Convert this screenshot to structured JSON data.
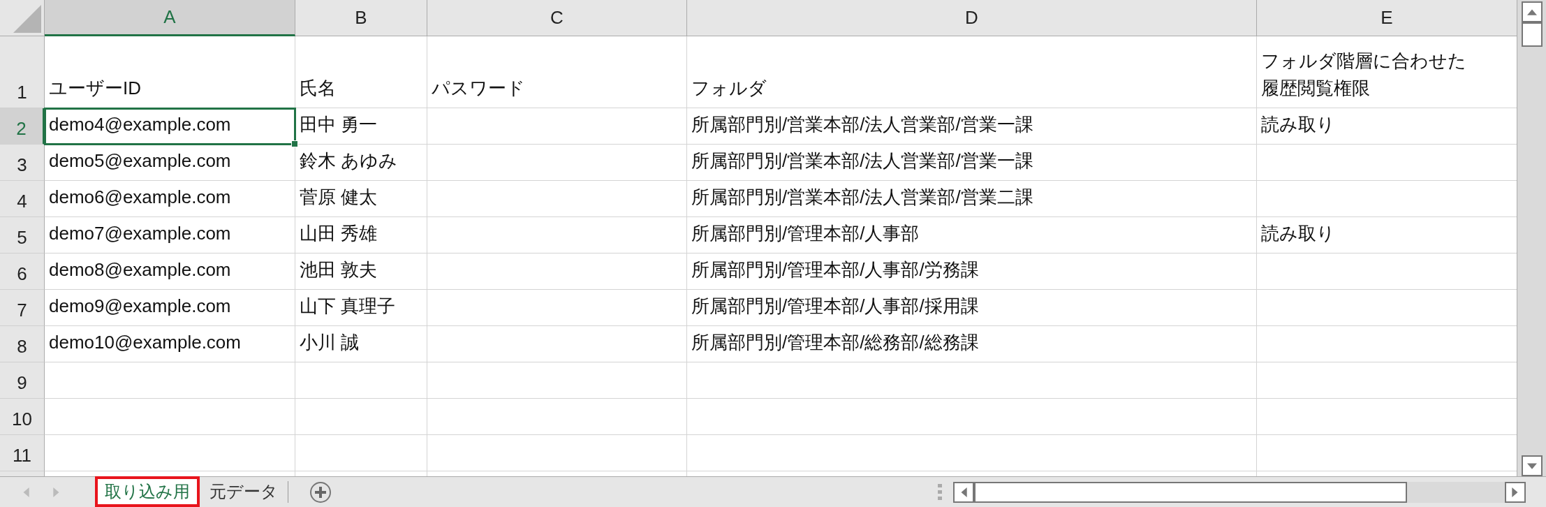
{
  "columns": [
    {
      "label": "A",
      "selected": true
    },
    {
      "label": "B",
      "selected": false
    },
    {
      "label": "C",
      "selected": false
    },
    {
      "label": "D",
      "selected": false
    },
    {
      "label": "E",
      "selected": false
    }
  ],
  "rows": [
    {
      "number": "1",
      "selected": false,
      "cells": [
        "ユーザーID",
        "氏名",
        "パスワード",
        "フォルダ",
        "フォルダ階層に合わせた履歴閲覧権限"
      ]
    },
    {
      "number": "2",
      "selected": true,
      "cells": [
        "demo4@example.com",
        "田中 勇一",
        null,
        "所属部門別/営業本部/法人営業部/営業一課",
        "読み取り"
      ]
    },
    {
      "number": "3",
      "selected": false,
      "cells": [
        "demo5@example.com",
        "鈴木 あゆみ",
        null,
        "所属部門別/営業本部/法人営業部/営業一課",
        null
      ]
    },
    {
      "number": "4",
      "selected": false,
      "cells": [
        "demo6@example.com",
        "菅原 健太",
        null,
        "所属部門別/営業本部/法人営業部/営業二課",
        null
      ]
    },
    {
      "number": "5",
      "selected": false,
      "cells": [
        "demo7@example.com",
        "山田 秀雄",
        null,
        "所属部門別/管理本部/人事部",
        "読み取り"
      ]
    },
    {
      "number": "6",
      "selected": false,
      "cells": [
        "demo8@example.com",
        "池田 敦夫",
        null,
        "所属部門別/管理本部/人事部/労務課",
        null
      ]
    },
    {
      "number": "7",
      "selected": false,
      "cells": [
        "demo9@example.com",
        "山下 真理子",
        null,
        "所属部門別/管理本部/人事部/採用課",
        null
      ]
    },
    {
      "number": "8",
      "selected": false,
      "cells": [
        "demo10@example.com",
        "小川 誠",
        null,
        "所属部門別/管理本部/総務部/総務課",
        null
      ]
    },
    {
      "number": "9",
      "selected": false,
      "cells": [
        null,
        null,
        null,
        null,
        null
      ]
    },
    {
      "number": "10",
      "selected": false,
      "cells": [
        null,
        null,
        null,
        null,
        null
      ]
    },
    {
      "number": "11",
      "selected": false,
      "cells": [
        null,
        null,
        null,
        null,
        null
      ]
    }
  ],
  "sheet_tabs": [
    {
      "label": "取り込み用",
      "selected": true,
      "highlighted": true
    },
    {
      "label": "元データ",
      "selected": false,
      "highlighted": false
    }
  ]
}
